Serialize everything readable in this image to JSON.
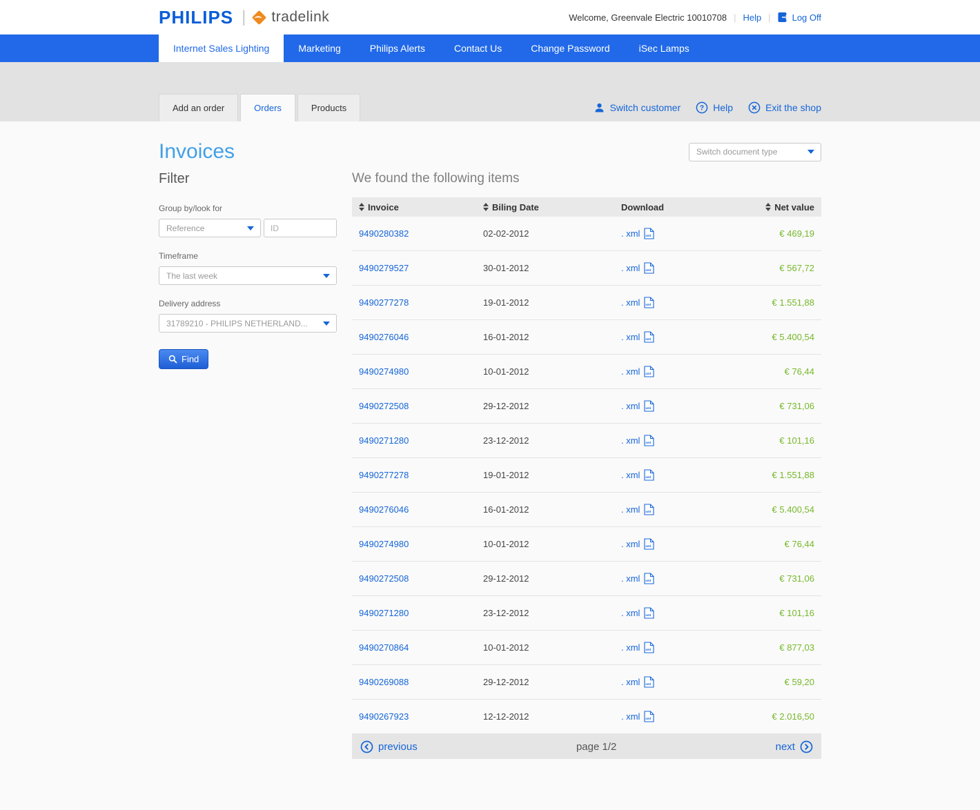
{
  "colors": {
    "nav_blue": "#2169e8",
    "link_blue": "#1565d8",
    "title_blue": "#41a0e8",
    "value_green": "#76b82a",
    "logo_orange": "#f08a1d"
  },
  "header": {
    "brand": "PHILIPS",
    "product": "tradelink",
    "welcome": "Welcome, Greenvale Electric 10010708",
    "help_label": "Help",
    "logoff_label": "Log Off"
  },
  "nav": {
    "items": [
      {
        "label": "Internet Sales Lighting",
        "active": true
      },
      {
        "label": "Marketing",
        "active": false
      },
      {
        "label": "Philips Alerts",
        "active": false
      },
      {
        "label": "Contact Us",
        "active": false
      },
      {
        "label": "Change Password",
        "active": false
      },
      {
        "label": "iSec Lamps",
        "active": false
      }
    ]
  },
  "subnav": {
    "tabs": [
      {
        "label": "Add an order",
        "active": false
      },
      {
        "label": "Orders",
        "active": true
      },
      {
        "label": "Products",
        "active": false
      }
    ],
    "switch_customer": "Switch customer",
    "help": "Help",
    "exit": "Exit the shop"
  },
  "page": {
    "title": "Invoices",
    "switch_document_type": "Switch document type",
    "results_heading": "We found the following items"
  },
  "filter": {
    "heading": "Filter",
    "group_label": "Group by/look for",
    "reference_value": "Reference",
    "id_placeholder": "ID",
    "timeframe_label": "Timeframe",
    "timeframe_value": "The last week",
    "delivery_label": "Delivery address",
    "delivery_value": "31789210 - PHILIPS NETHERLAND...",
    "find_label": "Find"
  },
  "table": {
    "columns": {
      "invoice": "Invoice",
      "billing_date": "Biling Date",
      "download": "Download",
      "net_value": "Net value"
    },
    "download_link_label": ". xml",
    "rows": [
      {
        "invoice": "9490280382",
        "date": "02-02-2012",
        "value": "€ 469,19"
      },
      {
        "invoice": "9490279527",
        "date": "30-01-2012",
        "value": "€ 567,72"
      },
      {
        "invoice": "9490277278",
        "date": "19-01-2012",
        "value": "€ 1.551,88"
      },
      {
        "invoice": "9490276046",
        "date": "16-01-2012",
        "value": "€ 5.400,54"
      },
      {
        "invoice": "9490274980",
        "date": "10-01-2012",
        "value": "€ 76,44"
      },
      {
        "invoice": "9490272508",
        "date": "29-12-2012",
        "value": "€ 731,06"
      },
      {
        "invoice": "9490271280",
        "date": "23-12-2012",
        "value": "€ 101,16"
      },
      {
        "invoice": "9490277278",
        "date": "19-01-2012",
        "value": "€ 1.551,88"
      },
      {
        "invoice": "9490276046",
        "date": "16-01-2012",
        "value": "€ 5.400,54"
      },
      {
        "invoice": "9490274980",
        "date": "10-01-2012",
        "value": "€ 76,44"
      },
      {
        "invoice": "9490272508",
        "date": "29-12-2012",
        "value": "€ 731,06"
      },
      {
        "invoice": "9490271280",
        "date": "23-12-2012",
        "value": "€ 101,16"
      },
      {
        "invoice": "9490270864",
        "date": "10-01-2012",
        "value": "€ 877,03"
      },
      {
        "invoice": "9490269088",
        "date": "29-12-2012",
        "value": "€ 59,20"
      },
      {
        "invoice": "9490267923",
        "date": "12-12-2012",
        "value": "€ 2.016,50"
      }
    ],
    "pager": {
      "previous_label": "previous",
      "page_label": "page 1/2",
      "next_label": "next"
    }
  }
}
